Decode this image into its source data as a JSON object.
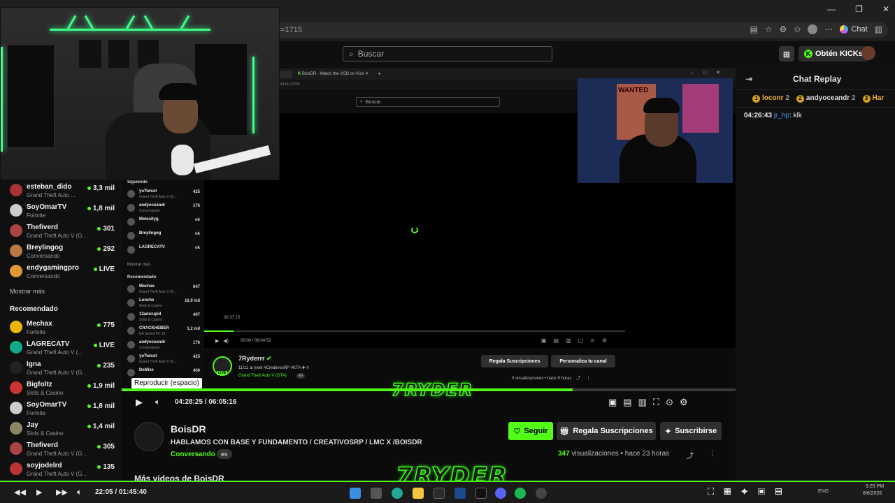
{
  "browser": {
    "url_fragment": "t=1715",
    "chat_button": "Chat",
    "window_controls": [
      "—",
      "❐",
      "✕"
    ]
  },
  "header": {
    "search_placeholder": "Buscar",
    "kicks_button": "Obtén KICKs"
  },
  "sidebar": {
    "following": [
      {
        "name": "esteban_dido",
        "game": "Grand Theft Auto ...",
        "count": "3,3 mil",
        "live": false,
        "color": "#a33"
      },
      {
        "name": "SoyOmarTV",
        "game": "Fortnite",
        "count": "1,8 mil",
        "live": false,
        "color": "#ccc"
      },
      {
        "name": "Thefiverd",
        "game": "Grand Theft Auto V (G...",
        "count": "301",
        "live": false,
        "color": "#a44"
      },
      {
        "name": "Breylingog",
        "game": "Conversando",
        "count": "292",
        "live": false,
        "color": "#b74"
      },
      {
        "name": "endygamingpro",
        "game": "Conversando",
        "count": "LIVE",
        "live": true,
        "color": "#d93"
      }
    ],
    "show_more": "Mostrar más",
    "recommended_title": "Recomendado",
    "recommended": [
      {
        "name": "Mechax",
        "game": "Fortnite",
        "count": "775",
        "color": "#e9b600"
      },
      {
        "name": "LAGRECATV",
        "game": "Grand Theft Auto V (...",
        "count": "LIVE",
        "color": "#1a8"
      },
      {
        "name": "Igna",
        "game": "Grand Theft Auto V (G...",
        "count": "235",
        "color": "#222"
      },
      {
        "name": "Bigfoltz",
        "game": "Slots & Casino",
        "count": "1,9 mil",
        "color": "#c33"
      },
      {
        "name": "SoyOmarTV",
        "game": "Fortnite",
        "count": "1,8 mil",
        "color": "#ccc"
      },
      {
        "name": "Jay",
        "game": "Slots & Casino",
        "count": "1,4 mil",
        "color": "#886"
      },
      {
        "name": "Thefiverd",
        "game": "Grand Theft Auto V (G...",
        "count": "305",
        "color": "#a44"
      },
      {
        "name": "soyjodelrd",
        "game": "Grand Theft Auto V (G...",
        "count": "135",
        "color": "#b33"
      }
    ]
  },
  "nested": {
    "tab1": "BoisDR - Watch the VOD on Kick",
    "url": "6efa1c234c",
    "search_placeholder": "Buscar",
    "following_title": "Siguiendo",
    "following": [
      {
        "name": "yoTwisst",
        "game": "Grand Theft Auto V (G...",
        "count": "425"
      },
      {
        "name": "andyoceandr",
        "game": "Conversando",
        "count": "176"
      },
      {
        "name": "Melosityg",
        "game": "",
        "count": "ok"
      },
      {
        "name": "Breylingog",
        "game": "",
        "count": "ok"
      },
      {
        "name": "LAGRECATV",
        "game": "",
        "count": "ok"
      }
    ],
    "show_more": "Mostrar más",
    "recommended_title": "Recomendado",
    "recommended": [
      {
        "name": "Mechax",
        "game": "Grand Theft Auto V (G...",
        "count": "647"
      },
      {
        "name": "Lonche",
        "game": "Slots & Casino",
        "count": "16,9 mil"
      },
      {
        "name": "12amcupid",
        "game": "Slots & Casino",
        "count": "497"
      },
      {
        "name": "CRACKHEBER",
        "game": "EA Sports FC 26",
        "count": "1,2 mil"
      },
      {
        "name": "andyoceandr",
        "game": "Conversando",
        "count": "176"
      },
      {
        "name": "yoTwisst",
        "game": "Grand Theft Auto V (G...",
        "count": "425"
      },
      {
        "name": "DeMize",
        "game": "",
        "count": "400"
      }
    ],
    "tooltip_time": "00:37:15",
    "time": "00:00 / 08:04:52",
    "streamer": "7Ryderrr",
    "title": "11/11 al nivel #CreativosRP #KTA ✚ !r",
    "category": "Grand Theft Auto V (GTA)",
    "lang": "es",
    "views": "0 visualizaciones",
    "ago": "hace 9 horas",
    "gift_btn": "Regala Suscripciones",
    "customize_btn": "Personaliza tu canal",
    "live_badge": "LIVE"
  },
  "chat": {
    "title": "Chat Replay",
    "top": [
      {
        "name": "loconr",
        "rank": "1",
        "value": "2"
      },
      {
        "name": "andyoceandr",
        "rank": "2",
        "value": "2"
      },
      {
        "name": "Har",
        "rank": "3",
        "value": ""
      }
    ],
    "messages": [
      {
        "time": "04:26:43",
        "user": "jr_hp",
        "text": "klk"
      }
    ]
  },
  "player": {
    "tooltip": "Reproducir (espacio)",
    "time": "04:28:25 / 06:05:16",
    "progress": 0.735
  },
  "video": {
    "streamer": "BoisDR",
    "title": "HABLAMOS CON BASE Y FUNDAMENTO / CREATIVOSRP / LMC X /BOISDR",
    "category": "Conversando",
    "lang": "es",
    "views_count": "347",
    "views_label": "visualizaciones",
    "ago": "hace 23 horas",
    "follow_btn": "Seguir",
    "gift_btn": "Regala Suscripciones",
    "subscribe_btn": "Suscribirse",
    "more_title": "Más videos de BoisDR"
  },
  "overlay": {
    "logo_text": "7RYDER"
  },
  "taskbar": {
    "time": "22:05 / 01:45:40",
    "clock": "9:25 PM",
    "date": "8/6/2026",
    "lang": "ENG"
  },
  "colors": {
    "accent": "#53fc18",
    "chat_user": "#4a9eff"
  }
}
